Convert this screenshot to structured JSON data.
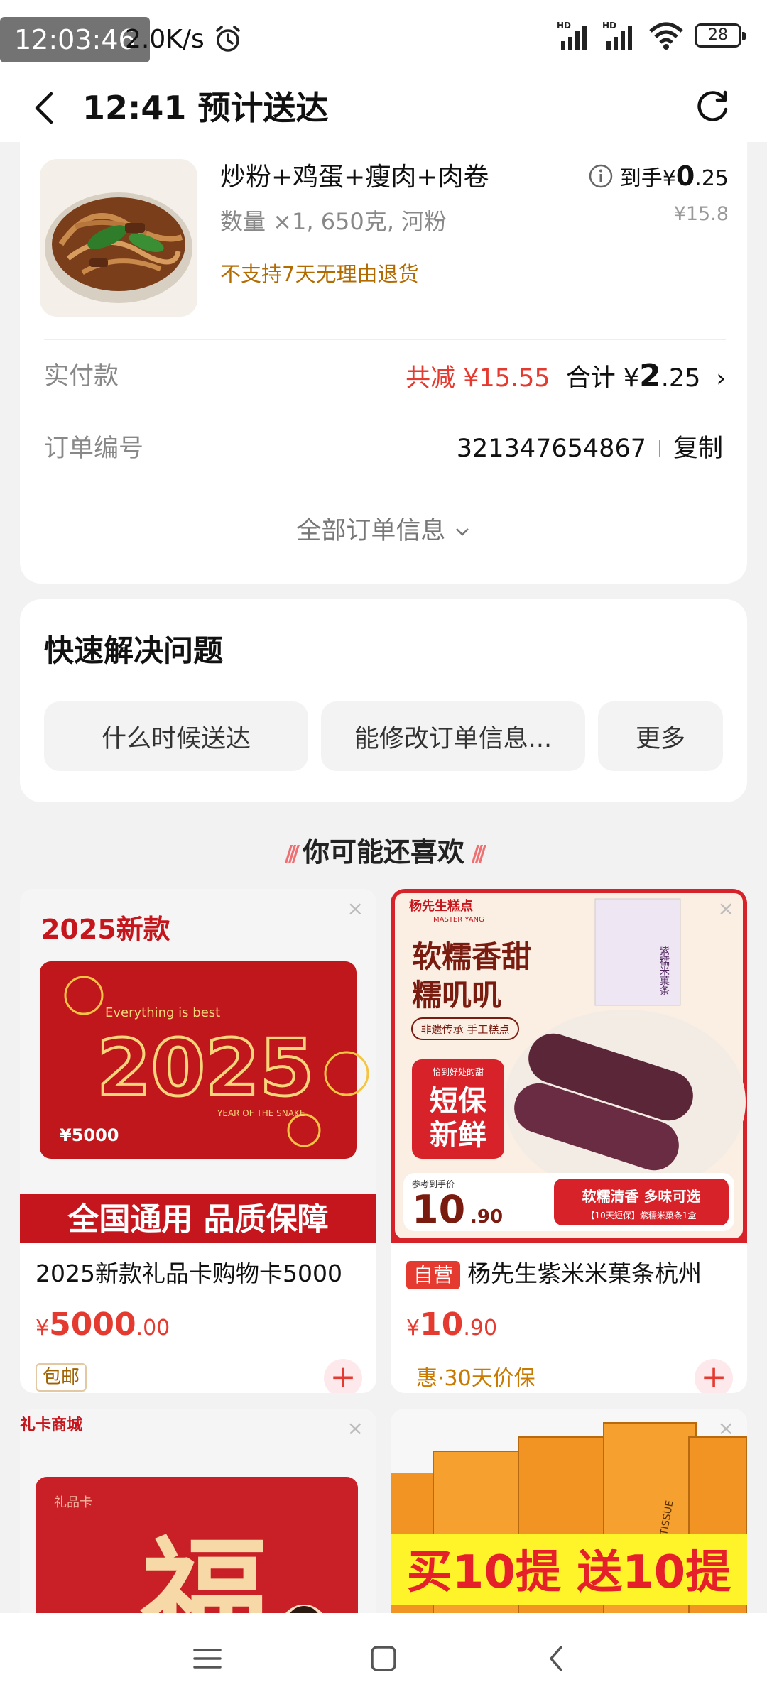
{
  "status_bar": {
    "time": "12:03:46",
    "speed": "2.0K/s",
    "battery": "28"
  },
  "header": {
    "title": "12:41 预计送达"
  },
  "order": {
    "product_name": "炒粉+鸡蛋+瘦肉+肉卷",
    "spec": "数量 ×1, 650克, 河粉",
    "return_policy": "不支持7天无理由退货",
    "to_hand_label": "到手¥",
    "to_hand_int": "0",
    "to_hand_dec": ".25",
    "original_price": "¥15.8",
    "paid_label": "实付款",
    "saving": "共减 ¥15.55",
    "total_label": "合计 ¥",
    "total_int": "2",
    "total_dec": ".25",
    "order_no_label": "订单编号",
    "order_no": "321347654867",
    "copy_label": "复制",
    "all_info": "全部订单信息"
  },
  "quick": {
    "title": "快速解决问题",
    "buttons": [
      "什么时候送达",
      "能修改订单信息...",
      "更多"
    ]
  },
  "recommend": {
    "title": "你可能还喜欢",
    "products": [
      {
        "title": "2025新款礼品卡购物卡5000",
        "currency": "¥",
        "price_int": "5000",
        "price_dec": ".00",
        "tag": "包邮",
        "img_text": {
          "headline": "2025新款",
          "slogan": "Everything is best",
          "year": "2025",
          "sub": "YEAR OF THE SNAKE",
          "value": "¥5000",
          "banner": "全国通用 品质保障"
        }
      },
      {
        "badge": "自营",
        "title": "杨先生紫米米菓条杭州",
        "currency": "¥",
        "price_int": "10",
        "price_dec": ".90",
        "perk": "惠·30天价保",
        "img_text": {
          "brand": "杨先生糕点",
          "brand_en": "MASTER YANG",
          "headline1": "软糯香甜",
          "headline2": "糯叽叽",
          "sub": "非遗传承 手工糕点",
          "fresh_tag": "恰到好处的甜",
          "fresh1": "短保",
          "fresh2": "新鲜",
          "box_text": "紫糯米菓条",
          "ref_price_label": "参考到手价",
          "ref_price_int": "10",
          "ref_price_dec": ".90",
          "taste": "软糯清香 多味可选",
          "spec": "【10天短保】紫糯米菓条1盒"
        }
      },
      {
        "img_text": {
          "shop": "礼卡商城",
          "card_label": "礼品卡",
          "fu": "福"
        }
      },
      {
        "img_text": {
          "box_label": "FACIAL TISSUE",
          "banner": "买10提 送10提"
        }
      }
    ]
  },
  "colors": {
    "accent": "#e53a2f",
    "gold": "#c97a00",
    "background": "#f2f2f2"
  }
}
